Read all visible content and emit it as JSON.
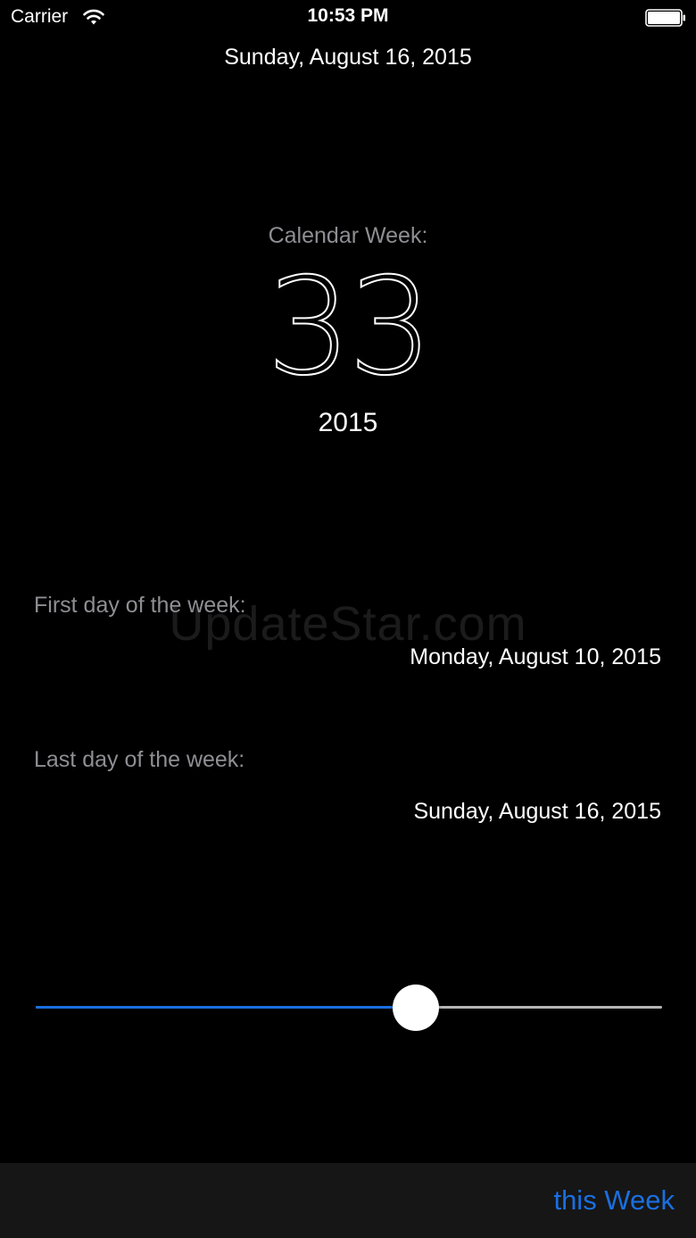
{
  "status_bar": {
    "carrier": "Carrier",
    "time": "10:53 PM",
    "wifi_icon": "wifi-icon",
    "battery_icon": "battery-icon"
  },
  "header": {
    "date": "Sunday, August 16, 2015"
  },
  "calendar_week": {
    "label": "Calendar Week:",
    "number": "33",
    "year": "2015"
  },
  "week_range": {
    "first_label": "First day of the week:",
    "first_value": "Monday, August 10, 2015",
    "last_label": "Last day of the week:",
    "last_value": "Sunday, August 16, 2015"
  },
  "watermark": "UpdateStar.com",
  "slider": {
    "value": 0.607,
    "fill_color": "#1a6fe0",
    "track_color": "#b5b5b5"
  },
  "toolbar": {
    "this_week_label": "this Week",
    "accent_color": "#1a6fe0"
  }
}
